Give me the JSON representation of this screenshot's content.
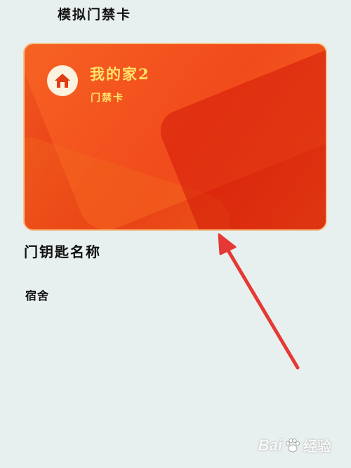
{
  "header": {
    "title": "模拟门禁卡"
  },
  "card": {
    "name": "我的家2",
    "subtitle": "门禁卡",
    "icon": "home-icon"
  },
  "fields": {
    "key_name_label": "门钥匙名称",
    "key_name_value": "宿舍"
  },
  "watermark": {
    "brand": "Bai",
    "suffix": "经验"
  },
  "colors": {
    "card": "#e83a14",
    "card_text": "#ffe36a",
    "arrow": "#e53935",
    "background": "#e8efef"
  }
}
